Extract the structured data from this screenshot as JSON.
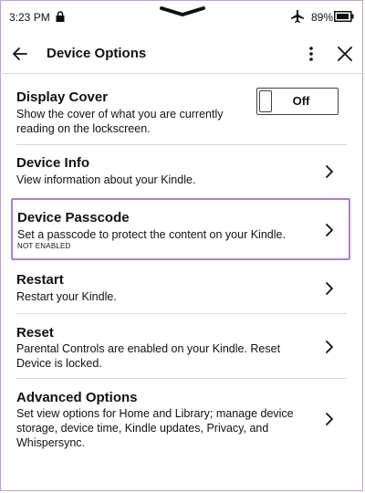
{
  "status": {
    "time": "3:23 PM",
    "battery": "89%",
    "icons": [
      "lock-icon",
      "airplane-icon",
      "battery-icon"
    ]
  },
  "header": {
    "title": "Device Options",
    "icons": [
      "back-arrow-icon",
      "more-vertical-icon",
      "close-icon"
    ]
  },
  "settings": {
    "display_cover": {
      "title": "Display Cover",
      "description": "Show the cover of what you are currently reading on the lockscreen.",
      "toggle_label": "Off"
    },
    "device_info": {
      "title": "Device Info",
      "description": "View information about your Kindle."
    },
    "device_passcode": {
      "title": "Device Passcode",
      "description": "Set a passcode to protect the content on your Kindle.",
      "status": "NOT ENABLED"
    },
    "restart": {
      "title": "Restart",
      "description": "Restart your Kindle."
    },
    "reset": {
      "title": "Reset",
      "description": "Parental Controls are enabled on your Kindle. Reset Device is locked."
    },
    "advanced": {
      "title": "Advanced Options",
      "description": "Set view options for Home and Library; manage device storage, device time, Kindle updates, Privacy, and Whispersync."
    }
  },
  "colors": {
    "highlight_border": "#b07fcf",
    "divider": "#d8d8d8",
    "text": "#111111"
  }
}
